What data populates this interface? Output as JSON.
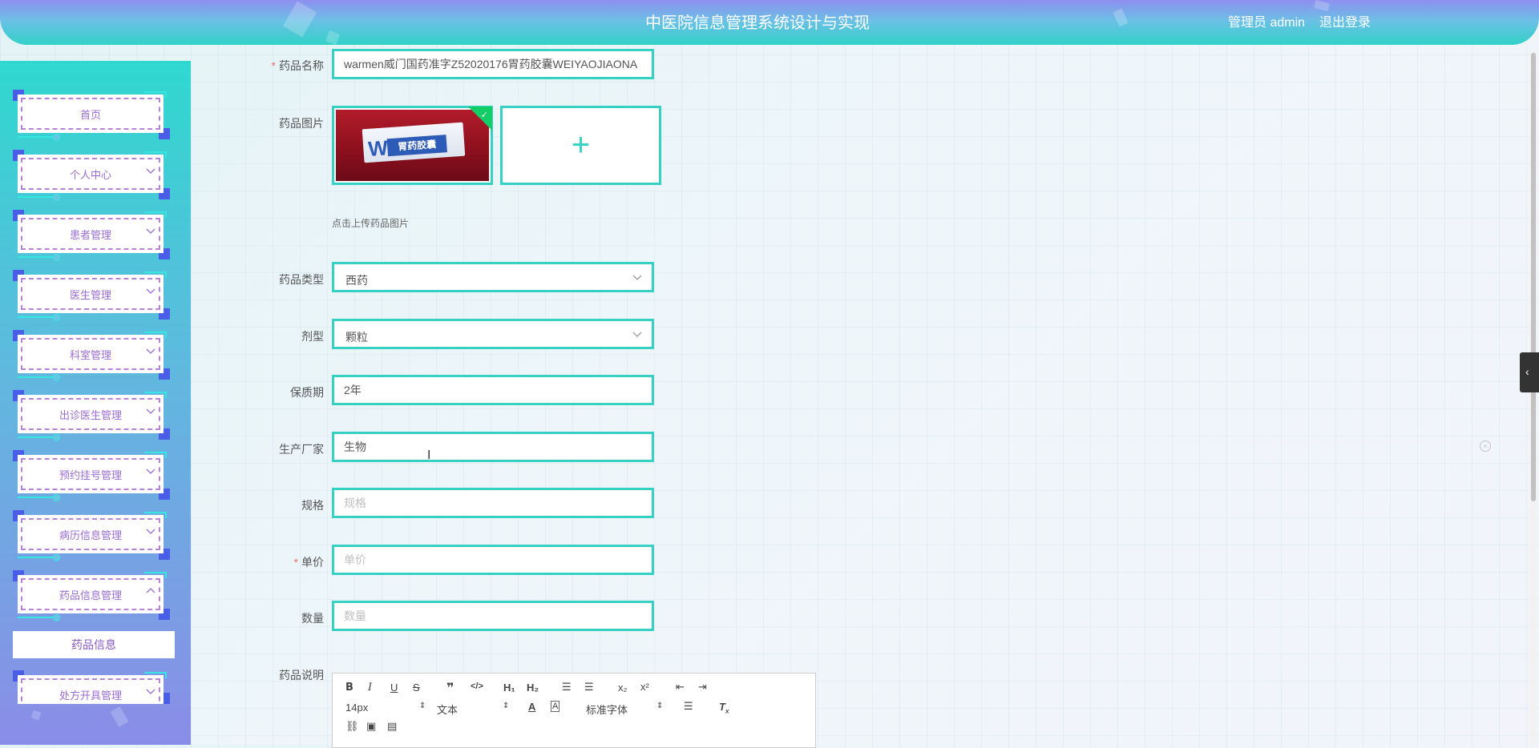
{
  "header": {
    "title": "中医院信息管理系统设计与实现",
    "user": "管理员 admin",
    "logout": "退出登录"
  },
  "sidebar": {
    "items": [
      {
        "label": "首页",
        "has_chevron": false
      },
      {
        "label": "个人中心",
        "has_chevron": true
      },
      {
        "label": "患者管理",
        "has_chevron": true
      },
      {
        "label": "医生管理",
        "has_chevron": true
      },
      {
        "label": "科室管理",
        "has_chevron": true
      },
      {
        "label": "出诊医生管理",
        "has_chevron": true
      },
      {
        "label": "预约挂号管理",
        "has_chevron": true
      },
      {
        "label": "病历信息管理",
        "has_chevron": true
      },
      {
        "label": "药品信息管理",
        "has_chevron": true,
        "expanded": true
      },
      {
        "label": "处方开具管理",
        "has_chevron": true
      }
    ],
    "subitem": "药品信息"
  },
  "form": {
    "name": {
      "label": "药品名称",
      "required": true,
      "value": "warmen威门国药准字Z52020176胃药胶囊WEIYAOJIAONA"
    },
    "image": {
      "label": "药品图片",
      "hint": "点击上传药品图片",
      "product_text": "胃药胶囊",
      "product_letter": "W"
    },
    "type": {
      "label": "药品类型",
      "value": "西药"
    },
    "dosage": {
      "label": "剂型",
      "value": "颗粒"
    },
    "shelf_life": {
      "label": "保质期",
      "value": "2年"
    },
    "maker": {
      "label": "生产厂家",
      "value": "生物"
    },
    "spec": {
      "label": "规格",
      "placeholder": "规格"
    },
    "price": {
      "label": "单价",
      "required": true,
      "placeholder": "单价"
    },
    "qty": {
      "label": "数量",
      "placeholder": "数量"
    },
    "desc": {
      "label": "药品说明"
    }
  },
  "editor": {
    "font_size": "14px",
    "block": "文本",
    "font": "标准字体"
  },
  "colors": {
    "accent": "#37d0c5",
    "menu_text": "#9b6cd0",
    "required": "#f56c6c"
  }
}
